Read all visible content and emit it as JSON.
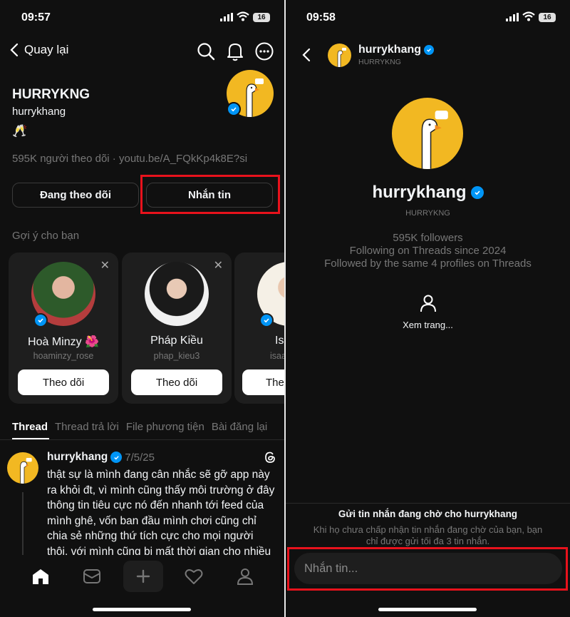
{
  "left": {
    "status": {
      "time": "09:57",
      "battery": "16"
    },
    "nav": {
      "back_label": "Quay lại"
    },
    "profile": {
      "display_name": "HURRYKNG",
      "username": "hurrykhang",
      "bio_emoji": "🥂",
      "meta": "595K người theo dõi · youtu.be/A_FQkKp4k8E?si"
    },
    "actions": {
      "following_label": "Đang theo dõi",
      "message_label": "Nhắn tin"
    },
    "suggestions": {
      "title": "Gợi ý cho bạn",
      "items": [
        {
          "name": "Hoà Minzy 🌺",
          "handle": "hoaminzy_rose",
          "button": "Theo dõi"
        },
        {
          "name": "Pháp Kiều",
          "handle": "phap_kieu3",
          "button": "Theo dõi"
        },
        {
          "name": "Isa",
          "handle": "isaa",
          "button": "The"
        }
      ]
    },
    "tabs": [
      "Thread",
      "Thread trả lời",
      "File phương tiện",
      "Bài đăng lại"
    ],
    "post": {
      "author": "hurrykhang",
      "date": "7/5/25",
      "lines": [
        "thật sự là mình đang cân nhắc sẽ gỡ app này",
        "ra khỏi đt, vì mình cũng thấy môi trường ở đây",
        "thông tin tiêu cực nó đến nhanh tới feed của",
        "mình ghê, vốn ban đầu mình chơi cũng chỉ",
        "chia sẻ những thứ tích cực cho mọi người",
        "thôi, với mình cũng bị mất thời gian cho nhiều"
      ]
    }
  },
  "right": {
    "status": {
      "time": "09:58",
      "battery": "16"
    },
    "header": {
      "username": "hurrykhang",
      "display_name": "HURRYKNG"
    },
    "profile": {
      "username": "hurrykhang",
      "display_name": "HURRYKNG",
      "followers": "595K followers",
      "since": "Following on Threads since 2024",
      "mutual": "Followed by the same 4 profiles on Threads",
      "view_profile": "Xem trang..."
    },
    "pending": {
      "title": "Gửi tin nhắn đang chờ cho hurrykhang",
      "desc_line1": "Khi họ chưa chấp nhận tin nhắn đang chờ của bạn, bạn",
      "desc_line2": "chỉ được gửi tối đa 3 tin nhắn."
    },
    "composer": {
      "placeholder": "Nhắn tin..."
    }
  },
  "colors": {
    "accent_red": "#e8121c",
    "verified_blue": "#0095f6",
    "avatar_yellow": "#f2b822"
  }
}
